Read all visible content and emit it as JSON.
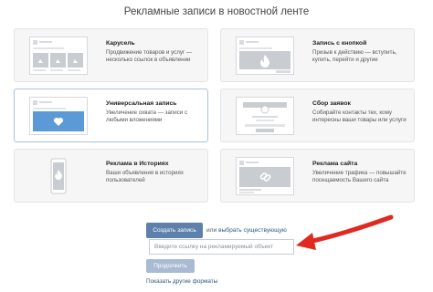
{
  "page": {
    "title": "Рекламные записи в новостной ленте"
  },
  "cards": [
    {
      "title": "Карусель",
      "description": "Продвижение товаров и услуг — несколько ссылок в объявлении",
      "thumb_icon": "carousel-icon"
    },
    {
      "title": "Запись с кнопкой",
      "description": "Призыв к действию — вступить, купить, перейти и другие",
      "thumb_icon": "fire-icon"
    },
    {
      "title": "Универсальная запись",
      "description": "Увеличение охвата — записи с любыми вложениями",
      "thumb_icon": "heart-icon"
    },
    {
      "title": "Сбор заявок",
      "description": "Собирайте контакты тех, кому интересны ваши товары или услуги",
      "thumb_icon": "form-icon"
    },
    {
      "title": "Реклама в Историях",
      "description": "Ваши объявления в историях пользователей",
      "thumb_icon": "fire-icon"
    },
    {
      "title": "Реклама сайта",
      "description": "Увеличение трафика — повышайте посещаемость Вашего сайта",
      "thumb_icon": "link-icon"
    }
  ],
  "actions": {
    "create_label": "Создать запись",
    "or_text": "или",
    "choose_existing_label": "выбрать существующую",
    "url_placeholder": "Введите ссылку на рекламируемый объект",
    "continue_label": "Продолжить",
    "show_other_label": "Показать другие форматы"
  },
  "colors": {
    "primary_button": "#5d81ab",
    "disabled_button": "#a8bbd2",
    "link": "#2a5885",
    "selected_border": "#a9c3de",
    "annotation_arrow": "#e02a20"
  }
}
